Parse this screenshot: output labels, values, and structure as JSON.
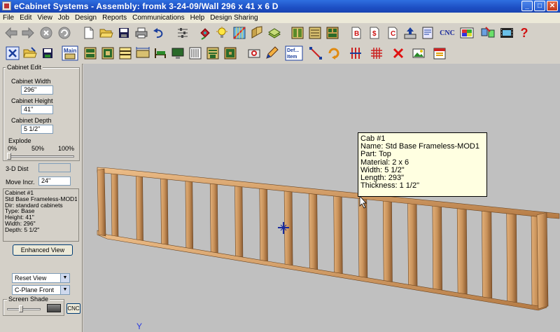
{
  "window": {
    "title": "eCabinet Systems - Assembly: fromk 3-24-09/Wall 296 x 41 x 6 D",
    "min_symbol": "_",
    "max_symbol": "□",
    "close_symbol": "✕"
  },
  "menu": [
    "File",
    "Edit",
    "View",
    "Job",
    "Design",
    "Reports",
    "Communications",
    "Help",
    "Design Sharing"
  ],
  "toolbar1": {
    "icons": [
      "back-arrow-icon",
      "forward-arrow-icon",
      "stop-icon",
      "refresh-icon",
      "new-document-icon",
      "open-folder-icon",
      "save-disk-icon",
      "print-icon",
      "undo-icon",
      "settings-sliders-icon",
      "pushpin-icon",
      "light-bulb-icon",
      "edit-grid-icon",
      "panel-icon",
      "stack-icon",
      "cabinet-icon",
      "cabinet-list-icon",
      "cabinet-grid-icon",
      "report-b-icon",
      "report-dollar-icon",
      "report-c-icon",
      "upload-icon",
      "reports-icon",
      "cnc-icon",
      "color-swatch-icon",
      "share-icon",
      "film-icon",
      "help-icon"
    ],
    "cnc_label": "CNC",
    "help_symbol": "?",
    "letters": {
      "b": "B",
      "dollar": "$",
      "c": "C"
    }
  },
  "toolbar2": {
    "icons": [
      "close-x-icon",
      "open-folder-icon",
      "save-disk-icon",
      "main-icon",
      "cabinet-front-icon",
      "cabinet-front2-icon",
      "shelves-icon",
      "dimension-icon",
      "bed-icon",
      "monitor-icon",
      "sliders-icon",
      "cabinet-open-icon",
      "cabinet-door-icon",
      "cabinet-drawers-icon",
      "camera-icon",
      "pencil-icon",
      "default-item-icon",
      "line-tool-icon",
      "rotate-icon",
      "vertical-bars-icon",
      "grid-icon",
      "delete-x-icon",
      "photo-icon",
      "calendar-icon"
    ],
    "main_label": "Main",
    "def_label": "Def...",
    "item_label": "Item"
  },
  "side_panel": {
    "group_title": "Cabinet Edit",
    "width_label": "Cabinet Width",
    "width_value": "296\"",
    "height_label": "Cabinet Height",
    "height_value": "41\"",
    "depth_label": "Cabinet Depth",
    "depth_value": "5 1/2\"",
    "explode_label": "Explode",
    "explode_ticks": [
      "0%",
      "50%",
      "100%"
    ],
    "explode_value": 0,
    "dist_label": "3-D Dist",
    "dist_value": "",
    "move_label": "Move Incr.",
    "move_value": "24\"",
    "info_lines": [
      "Cabinet #1",
      "Std Base Frameless-MOD1",
      "Dir: standard cabinets",
      "Type: Base",
      "Height: 41\"",
      "Width: 296\"",
      "Depth: 5 1/2\""
    ],
    "enhanced_view_label": "Enhanced View",
    "view_select": "Reset View",
    "plane_select": "C-Plane Front",
    "shade_label": "Screen Shade",
    "shade_value": 0.4,
    "cnc_label": "CNC"
  },
  "viewport": {
    "tooltip_lines": [
      "Cab #1",
      "Name: Std Base Frameless-MOD1",
      "Part: Top",
      "Material: 2 x 6",
      "Width: 5 1/2\"",
      "Length: 293\"",
      "Thickness: 1 1/2\""
    ],
    "axis_label": "Y",
    "background_color": "#c0c0c0",
    "stud_count": 18
  }
}
